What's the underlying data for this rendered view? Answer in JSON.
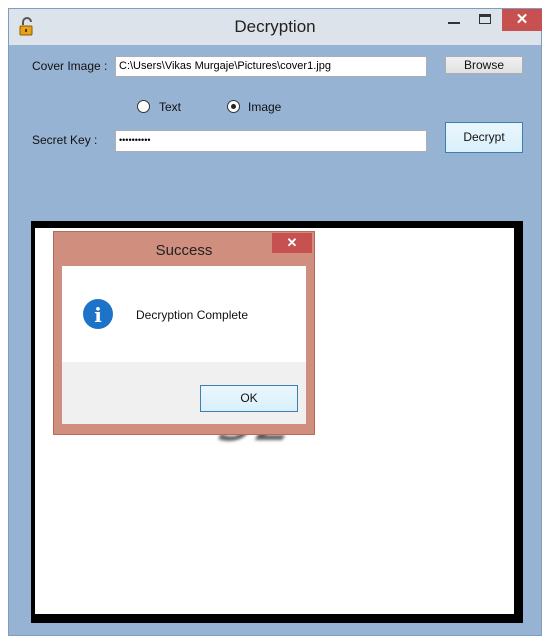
{
  "window": {
    "title": "Decryption",
    "controls": {
      "minimize_icon": "minimize-icon",
      "maximize_icon": "maximize-icon",
      "close_glyph": "✕"
    }
  },
  "form": {
    "cover_label": "Cover Image :",
    "cover_path": "C:\\Users\\Vikas Murgaje\\Pictures\\cover1.jpg",
    "browse_label": "Browse",
    "radio_text_label": "Text",
    "radio_image_label": "Image",
    "selected_mode": "Image",
    "secret_label": "Secret Key :",
    "secret_value": "••••••••••",
    "decrypt_label": "Decrypt"
  },
  "dialog": {
    "title": "Success",
    "close_glyph": "✕",
    "icon": "info-icon",
    "icon_glyph": "i",
    "message": "Decryption Complete",
    "ok_label": "OK"
  },
  "picture": {
    "partial_text": "32"
  },
  "colors": {
    "window_bg": "#96b3d4",
    "titlebar_bg": "#dde3ea",
    "close_red": "#c75050",
    "dialog_frame": "#cf8e7e",
    "info_blue": "#1c73c8"
  }
}
